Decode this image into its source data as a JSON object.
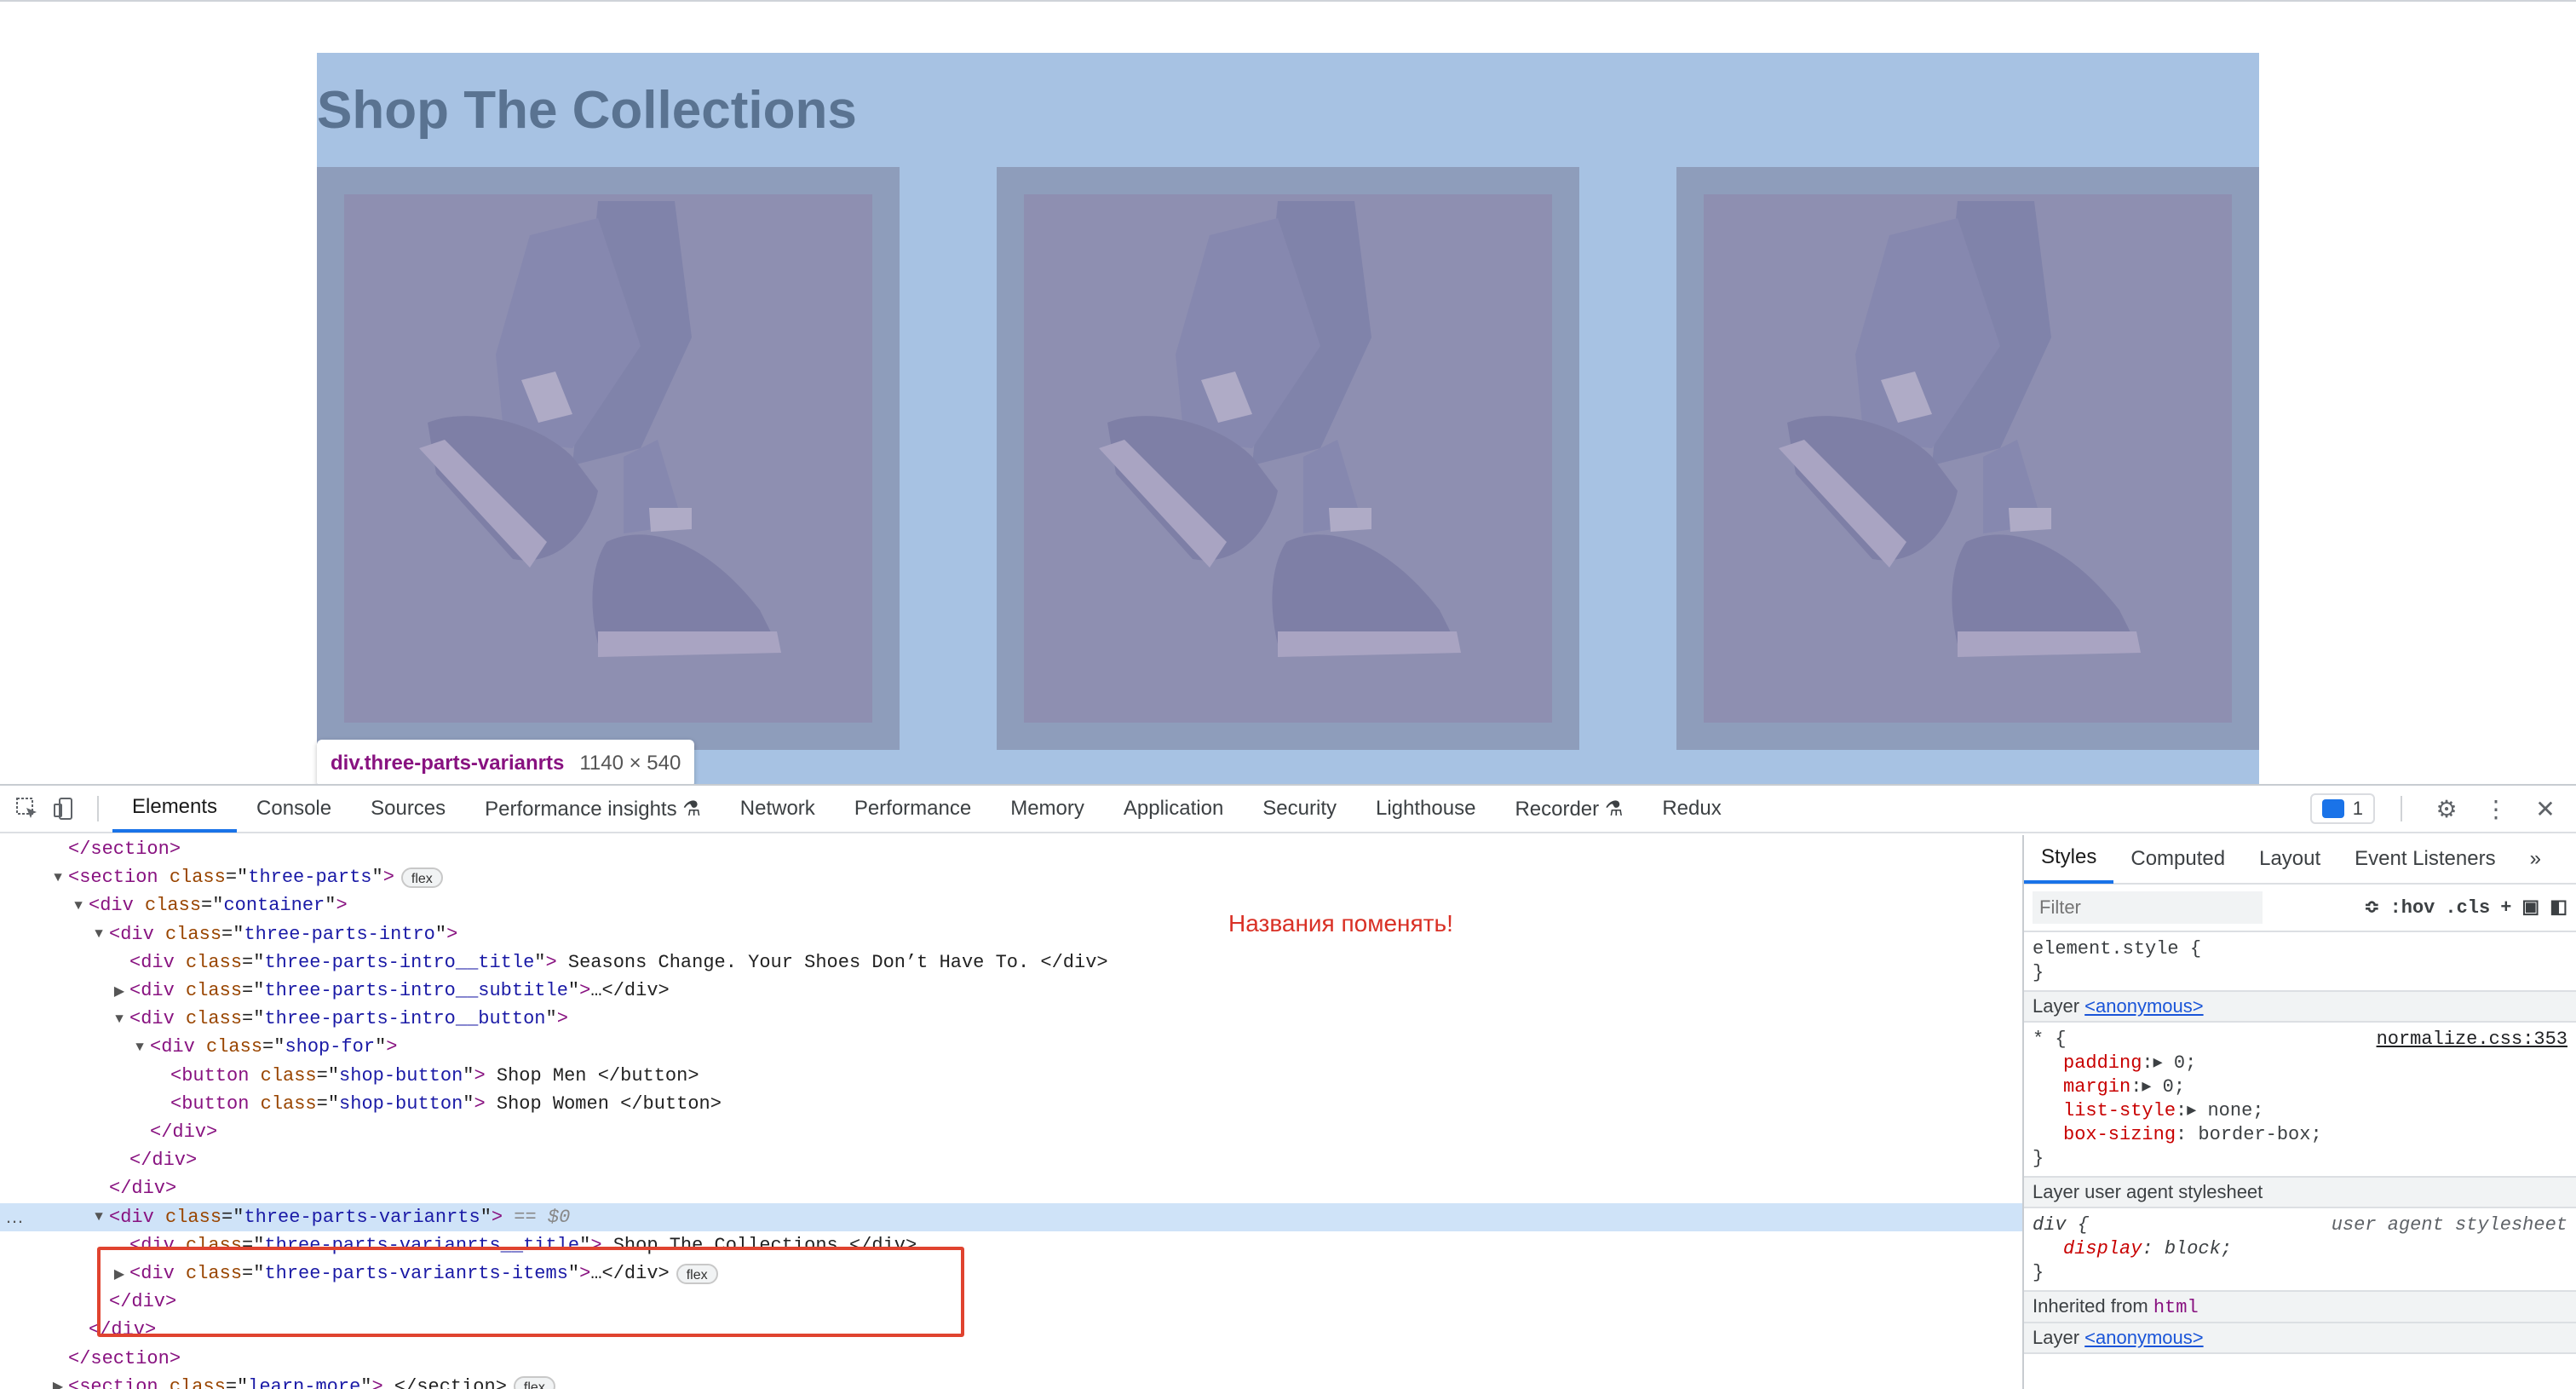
{
  "viewport": {
    "title": "Shop The Collections",
    "tooltip": {
      "selector": "div.three-parts-varianrts",
      "size": "1140 × 540"
    }
  },
  "toolbar": {
    "tabs": [
      "Elements",
      "Console",
      "Sources",
      "Performance insights ⚗",
      "Network",
      "Performance",
      "Memory",
      "Application",
      "Security",
      "Lighthouse",
      "Recorder ⚗",
      "Redux"
    ],
    "active_tab": "Elements",
    "issues_count": "1"
  },
  "dom": {
    "lines": [
      {
        "indent": 1,
        "tri": "",
        "html": "</section>"
      },
      {
        "indent": 1,
        "tri": "▼",
        "tag": "section",
        "class": "three-parts",
        "tail": "",
        "badge": "flex"
      },
      {
        "indent": 2,
        "tri": "▼",
        "tag": "div",
        "class": "container",
        "tail": ""
      },
      {
        "indent": 3,
        "tri": "▼",
        "tag": "div",
        "class": "three-parts-intro",
        "tail": ""
      },
      {
        "indent": 4,
        "tri": "",
        "tag": "div",
        "class": "three-parts-intro__title",
        "tail": " Seasons Change. Your Shoes Don’t Have To. </div>"
      },
      {
        "indent": 4,
        "tri": "▶",
        "tag": "div",
        "class": "three-parts-intro__subtitle",
        "tail": "…</div>"
      },
      {
        "indent": 4,
        "tri": "▼",
        "tag": "div",
        "class": "three-parts-intro__button",
        "tail": ""
      },
      {
        "indent": 5,
        "tri": "▼",
        "tag": "div",
        "class": "shop-for",
        "tail": ""
      },
      {
        "indent": 6,
        "tri": "",
        "tag": "button",
        "class": "shop-button",
        "tail": " Shop Men </button>"
      },
      {
        "indent": 6,
        "tri": "",
        "tag": "button",
        "class": "shop-button",
        "tail": " Shop Women </button>"
      },
      {
        "indent": 5,
        "tri": "",
        "html": "</div>"
      },
      {
        "indent": 4,
        "tri": "",
        "html": "</div>"
      },
      {
        "indent": 3,
        "tri": "",
        "html": "</div>"
      },
      {
        "indent": 3,
        "tri": "▼",
        "tag": "div",
        "class": "three-parts-varianrts",
        "tail": "",
        "selected": true,
        "dollar": " == $0"
      },
      {
        "indent": 4,
        "tri": "",
        "tag": "div",
        "class": "three-parts-varianrts__title",
        "tail": " Shop The Collections </div>"
      },
      {
        "indent": 4,
        "tri": "▶",
        "tag": "div",
        "class": "three-parts-varianrts-items",
        "tail": "…</div>",
        "badge": "flex"
      },
      {
        "indent": 3,
        "tri": "",
        "html": "</div>"
      },
      {
        "indent": 2,
        "tri": "",
        "html": "</div>"
      },
      {
        "indent": 1,
        "tri": "",
        "html": "</section>"
      },
      {
        "indent": 1,
        "tri": "▶",
        "tag": "section",
        "class": "learn-more",
        "tail": "…</section>",
        "badge": "flex"
      }
    ],
    "annotation": "Названия поменять!",
    "ellipsis": "…"
  },
  "styles": {
    "tabs": [
      "Styles",
      "Computed",
      "Layout",
      "Event Listeners",
      "»"
    ],
    "active_tab": "Styles",
    "filter_placeholder": "Filter",
    "hov": ":hov",
    "cls": ".cls",
    "element_style": "element.style {",
    "close": "}",
    "layer1_label": "Layer",
    "layer1_link": "<anonymous>",
    "universal_selector": "* {",
    "universal_source": "normalize.css:353",
    "universal_props": [
      {
        "name": "padding",
        "value": "▸ 0;"
      },
      {
        "name": "margin",
        "value": "▸ 0;"
      },
      {
        "name": "list-style",
        "value": "▸ none;"
      },
      {
        "name": "box-sizing",
        "value": " border-box;"
      }
    ],
    "layer2_label": "Layer user agent stylesheet",
    "ua_selector": "div {",
    "ua_source": "user agent stylesheet",
    "ua_prop": {
      "name": "display",
      "value": " block;"
    },
    "inherited_label": "Inherited from",
    "inherited_tag": "html",
    "layer3_label": "Layer",
    "layer3_link": "<anonymous>"
  }
}
